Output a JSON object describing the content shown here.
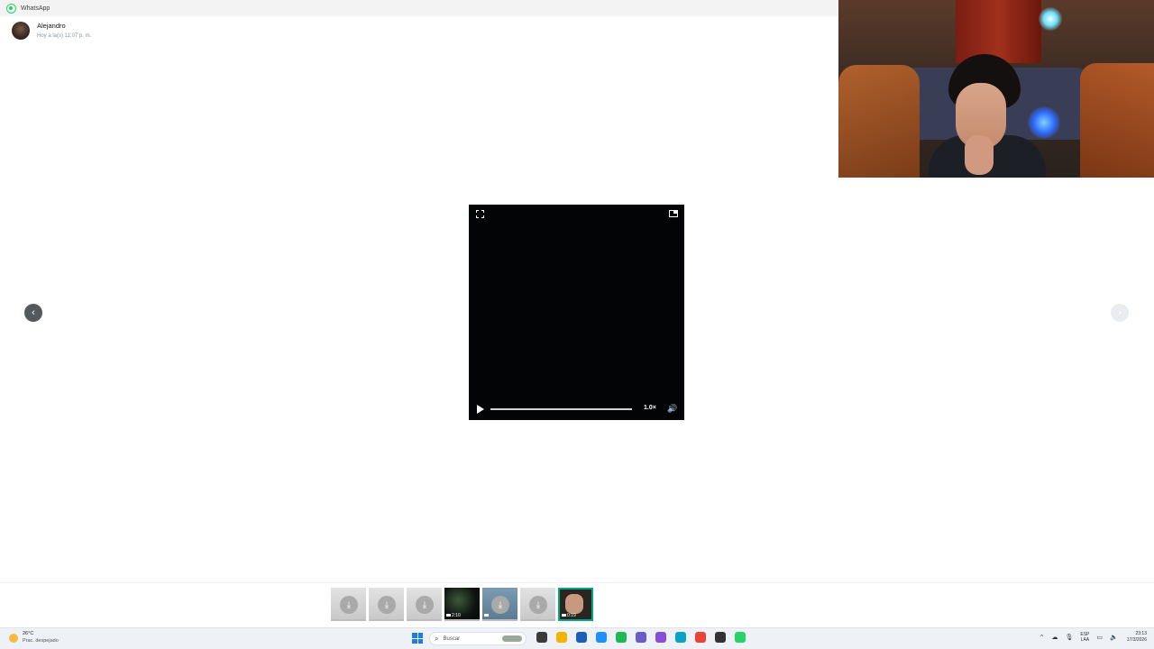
{
  "window": {
    "app_name": "WhatsApp"
  },
  "media_viewer": {
    "sender_name": "Alejandro",
    "timestamp": "Hoy a la(s) 11:07 p. m.",
    "player": {
      "playback_speed": "1.0×",
      "progress": 0.0
    },
    "thumbnails": [
      {
        "type": "download",
        "duration": ""
      },
      {
        "type": "download",
        "duration": ""
      },
      {
        "type": "download",
        "duration": ""
      },
      {
        "type": "video",
        "duration": "2:10"
      },
      {
        "type": "download-video",
        "duration": ""
      },
      {
        "type": "download",
        "duration": ""
      },
      {
        "type": "video-selected",
        "duration": "0:19"
      }
    ],
    "icons": {
      "prev": "‹",
      "next": "›",
      "cursor": "☝",
      "volume": "🔊",
      "download": "⤓"
    }
  },
  "taskbar": {
    "weather_temp": "26°C",
    "weather_condition": "Prac. despejado",
    "search_placeholder": "Buscar",
    "language_line1": "ESP",
    "language_line2": "LAA",
    "time": "23:13",
    "date": "17/3/2026",
    "app_colors": [
      "#3b3b3b",
      "#f2b400",
      "#1d5fb8",
      "#1e90ff",
      "#1db954",
      "#6a5acd",
      "#8a4fd8",
      "#0aa3c2",
      "#ea4335",
      "#333333",
      "#25d366"
    ]
  }
}
